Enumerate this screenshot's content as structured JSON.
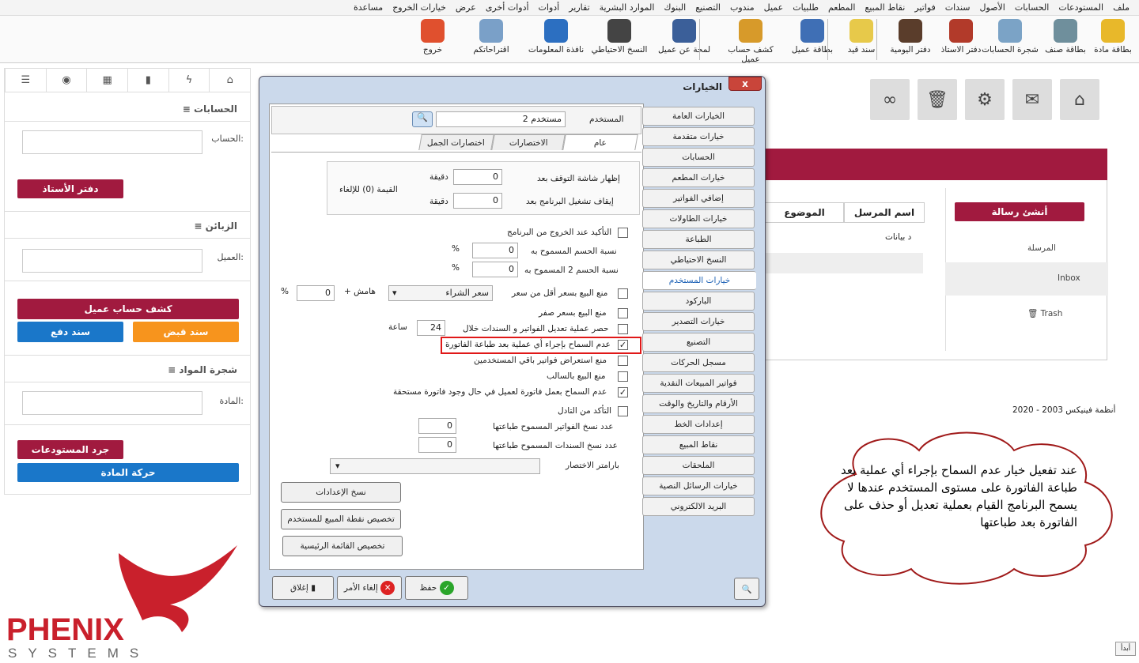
{
  "menu": [
    "ملف",
    "المستودعات",
    "الحسابات",
    "الأصول",
    "سندات",
    "فواتير",
    "نقاط المبيع",
    "المطعم",
    "طلبيات",
    "عميل",
    "مندوب",
    "التصنيع",
    "البنوك",
    "الموارد البشرية",
    "تقارير",
    "أدوات",
    "أدوات أخرى",
    "عرض",
    "خيارات الخروج",
    "مساعدة"
  ],
  "toolbar": {
    "items": [
      {
        "label": "بطاقة مادة",
        "icon": "cube-icon",
        "color": "#e8b82a"
      },
      {
        "label": "بطاقة صنف",
        "icon": "database-icon",
        "color": "#6f8f9c"
      },
      {
        "label": "شجرة الحسابات",
        "icon": "tree-icon",
        "color": "#7ba3c6"
      },
      {
        "label": "دفتر الاستاذ",
        "icon": "ledger-icon",
        "color": "#b23a2a"
      },
      {
        "label": "دفتر اليومية",
        "icon": "journal-icon",
        "color": "#5a3d2b"
      },
      {
        "label": "سند قيد",
        "icon": "receipt-icon",
        "color": "#e7c94a"
      },
      {
        "label": "بطاقة عميل",
        "icon": "user-card-icon",
        "color": "#3f6fb5"
      },
      {
        "label": "كشف حساب عميل",
        "icon": "user-statement-icon",
        "color": "#d79a2a"
      },
      {
        "label": "لمحة عن عميل",
        "icon": "users-icon",
        "color": "#3b5f99"
      },
      {
        "label": "النسخ الاحتياطي",
        "icon": "floppy-icon",
        "color": "#444"
      },
      {
        "label": "نافذة المعلومات",
        "icon": "info-icon",
        "color": "#2c6fc1"
      },
      {
        "label": "اقتراحاتكم",
        "icon": "suggestion-icon",
        "color": "#7aa0c8"
      },
      {
        "label": "خروج",
        "icon": "exit-icon",
        "color": "#e0502e"
      }
    ]
  },
  "left": {
    "tabs": [
      "home-icon",
      "bolt-icon",
      "bookmark-icon",
      "calendar-icon",
      "rss-icon",
      "list-icon"
    ],
    "accounts": {
      "title": "الحسابات",
      "label": "الحساب:",
      "btn": "دفتر الأستاذ"
    },
    "customers": {
      "title": "الزبائن",
      "label": "العميل:",
      "btn_statement": "كشف حساب عميل",
      "btn_receipt": "سند قبض",
      "btn_payment": "سند دفع"
    },
    "materials": {
      "title": "شجرة المواد",
      "label": "المادة:",
      "btn_inventory": "جرد المستودعات",
      "btn_movement": "حركة المادة"
    }
  },
  "main": {
    "icons": [
      "home-icon",
      "envelope-icon",
      "gears-icon",
      "trash-icon",
      "link-icon"
    ],
    "compose": "أنشئ رسالة",
    "folders": {
      "sent": "المرسلة",
      "inbox": "Inbox",
      "trash": "Trash"
    },
    "cols": {
      "sender": "اسم المرسل",
      "subject": "الموضوع"
    },
    "empty": "د بيانات",
    "copyright": "أنظمة فينيكس 2003 - 2020"
  },
  "dialog": {
    "title": "الخيارات",
    "close": "x",
    "user_label": "المستخدم",
    "user_value": "مستخدم 2",
    "tabs": [
      "عام",
      "الاختصارات",
      "اختصارات الجمل"
    ],
    "sidebar": [
      "الخيارات العامة",
      "خيارات متقدمة",
      "الحسابات",
      "خيارات المطعم",
      "إضافي الفواتير",
      "خيارات الطاولات",
      "الطباعة",
      "النسخ الاحتياطي",
      "خيارات المستخدم",
      "الباركود",
      "خيارات التصدير",
      "التصنيع",
      "مسجل الحركات",
      "فواتير المبيعات النقدية",
      "الأرقام والتاريخ والوقت",
      "إعدادات الخط",
      "نقاط المبيع",
      "الملحقات",
      "خيارات الرسائل النصية",
      "البريد الالكتروني"
    ],
    "selected_index": 8,
    "idle": {
      "show_label": "إظهار شاشة التوقف بعد",
      "show_value": "0",
      "stop_label": "إيقاف تشغيل البرنامج بعد",
      "stop_value": "0",
      "minute": "دقيقة",
      "hint": "القيمة (0) للإلغاء"
    },
    "confirm_exit": "التأكيد عند الخروج من البرنامج",
    "discount1_label": "نسبة الحسم المسموح به",
    "discount1_value": "0",
    "discount2_label": "نسبة الحسم 2 المسموح به",
    "discount2_value": "0",
    "percent": "%",
    "prevent_below": "منع البيع بسعر أقل من سعر",
    "price_select": "سعر الشراء",
    "margin_label": "+ هامش",
    "margin_value": "0",
    "prevent_zero": "منع البيع بسعر صفر",
    "limit_edit": "حصر عملية تعديل الفواتير و السندات خلال",
    "limit_value": "24",
    "hours": "ساعة",
    "no_after_print": "عدم السماح بإجراء أي عملية بعد طباعة الفاتورة",
    "no_view_others": "منع استعراض فواتير باقي المستخدمين",
    "no_negative": "منع البيع بالسالب",
    "no_invoice_due": "عدم السماح بعمل فاتورة لعميل في حال وجود فاتورة مستحقة",
    "confirm_trade": "التأكد من التادل",
    "invoice_copies_label": "عدد نسخ الفواتير المسموح طباعتها",
    "invoice_copies": "0",
    "voucher_copies_label": "عدد نسخ السندات المسموح طباعتها",
    "voucher_copies": "0",
    "shortcut_label": "بارامتر الاختصار",
    "btn_copy": "نسخ الإعدادات",
    "btn_pos": "تخصيص نقطة المبيع للمستخدم",
    "btn_menu": "تخصيص القائمة الرئيسية",
    "save": "حفظ",
    "cancel": "إلغاء الأمر",
    "close_btn": "إغلاق"
  },
  "callout": "عند تفعيل خيار عدم السماح بإجراء أي عملية بعد طباعة الفاتورة على مستوى المستخدم عندها  لا يسمح البرنامج القيام بعملية تعديل أو حذف على  الفاتورة بعد طباعتها",
  "logo": {
    "name": "PHENIX",
    "sub": "SYSTEMS"
  },
  "corner": "أبدأ"
}
